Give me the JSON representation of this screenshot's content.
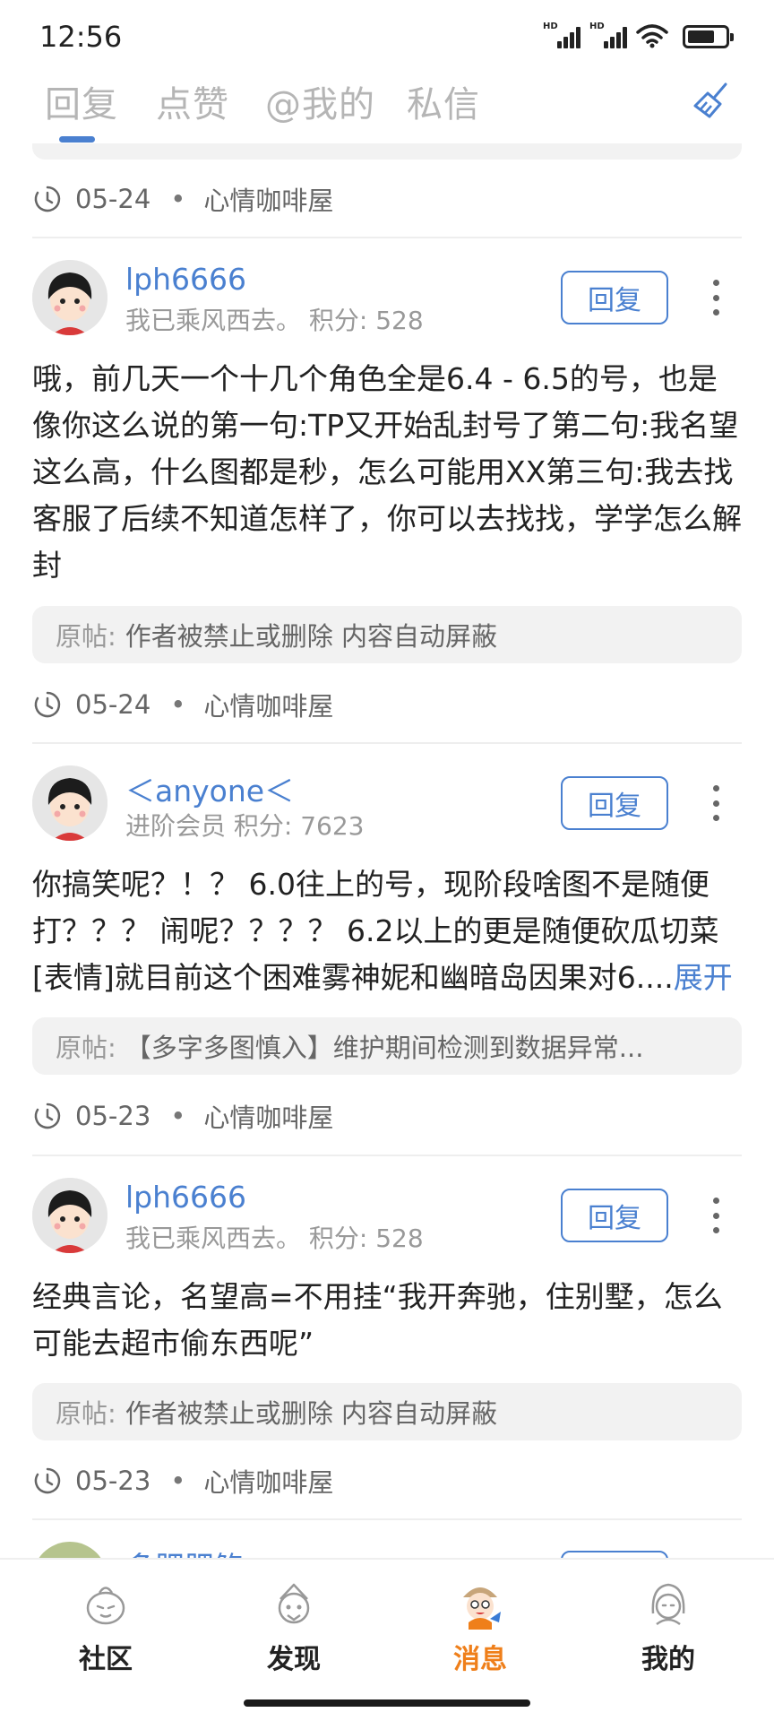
{
  "status_bar": {
    "time": "12:56",
    "signal_label": "HD",
    "battery_level": 0.72
  },
  "tabs": [
    {
      "label": "回复",
      "active": true
    },
    {
      "label": "点赞",
      "active": false
    },
    {
      "label": "@我的",
      "active": false
    },
    {
      "label": "私信",
      "active": false
    }
  ],
  "icons": {
    "clear": "broom-icon",
    "time": "clock-icon",
    "more": "more-vertical-icon",
    "nav": [
      "community-icon",
      "discover-icon",
      "messages-icon",
      "profile-icon"
    ]
  },
  "colors": {
    "accent": "#4a80d0",
    "nav_active": "#ef7f1a",
    "card_bg": "#f2f2f2"
  },
  "top_meta": {
    "date": "05-24",
    "separator": "•",
    "forum": "心情咖啡屋"
  },
  "reply_button_label": "回复",
  "quote_label": "原帖:",
  "items": [
    {
      "username": "lph6666",
      "title": "我已乘风西去。 积分: 528",
      "content": "哦，前几天一个十几个角色全是6.4 - 6.5的号，也是像你这么说的第一句:TP又开始乱封号了第二句:我名望这么高，什么图都是秒，怎么可能用XX第三句:我去找客服了后续不知道怎样了，你可以去找找，学学怎么解封",
      "expand": "",
      "quote": "作者被禁止或删除 内容自动屏蔽",
      "date": "05-24",
      "separator": "•",
      "forum": "心情咖啡屋"
    },
    {
      "username": "＜anyone＜",
      "title": "进阶会员 积分: 7623",
      "content": "你搞笑呢？！？ 6.0往上的号，现阶段啥图不是随便打？？？ 闹呢？？？？ 6.2以上的更是随便砍瓜切菜[表情]就目前这个困难雾神妮和幽暗岛因果对6....",
      "expand": "展开",
      "quote": "【多字多图慎入】维护期间检测到数据异常...",
      "date": "05-23",
      "separator": "•",
      "forum": "心情咖啡屋"
    },
    {
      "username": "lph6666",
      "title": "我已乘风西去。 积分: 528",
      "content": "经典言论，名望高=不用挂“我开奔驰，住别墅，怎么可能去超市偷东西呢”",
      "expand": "",
      "quote": "作者被禁止或删除 内容自动屏蔽",
      "date": "05-23",
      "separator": "•",
      "forum": "心情咖啡屋"
    }
  ],
  "partial_item": {
    "username": "多肥肥鲍"
  },
  "bottom_nav": [
    {
      "label": "社区",
      "active": false
    },
    {
      "label": "发现",
      "active": false
    },
    {
      "label": "消息",
      "active": true
    },
    {
      "label": "我的",
      "active": false
    }
  ]
}
